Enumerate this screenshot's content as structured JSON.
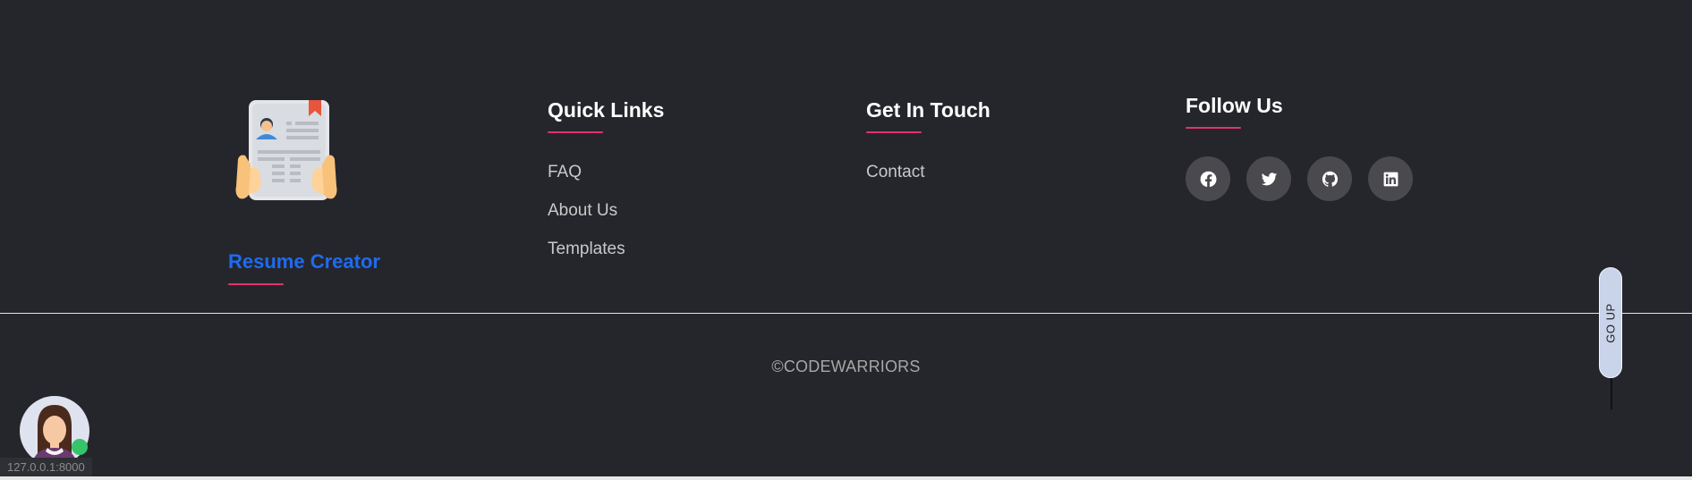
{
  "brand": {
    "name": "Resume Creator",
    "icon": "resume-logo-icon"
  },
  "quick_links": {
    "title": "Quick Links",
    "items": [
      {
        "label": "FAQ"
      },
      {
        "label": "About Us"
      },
      {
        "label": "Templates"
      }
    ]
  },
  "get_in_touch": {
    "title": "Get In Touch",
    "items": [
      {
        "label": "Contact"
      }
    ]
  },
  "follow_us": {
    "title": "Follow Us",
    "socials": [
      {
        "icon": "facebook-icon"
      },
      {
        "icon": "twitter-icon"
      },
      {
        "icon": "github-icon"
      },
      {
        "icon": "linkedin-icon"
      }
    ]
  },
  "footer": {
    "copyright": "©CODEWARRIORS"
  },
  "go_up": {
    "label": "GO UP"
  },
  "status_bar": {
    "url": "127.0.0.1:8000"
  },
  "colors": {
    "background": "#25262c",
    "accent_underline": "#e23368",
    "brand_blue": "#1e6bf0",
    "online": "#35c46b"
  }
}
